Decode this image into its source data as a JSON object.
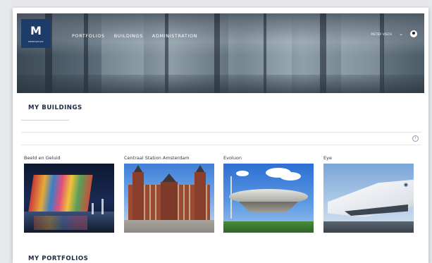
{
  "header": {
    "logo_text": "M",
    "logo_subtext": "MEERSPOOR",
    "nav": [
      "PORTFOLIOS",
      "BUILDINGS",
      "ADMINISTRATION"
    ],
    "username": "PIETER VISCH",
    "user_menu_icon": "chevron-down-icon",
    "avatar_icon": "user-avatar-icon"
  },
  "buildings_section": {
    "title": "MY BUILDINGS",
    "info_icon": "i",
    "items": [
      {
        "name": "Beeld en Geluid"
      },
      {
        "name": "Centraal Station Amsterdam"
      },
      {
        "name": "Evoluon"
      },
      {
        "name": "Eye"
      }
    ]
  },
  "portfolios_section": {
    "title": "MY PORTFOLIOS"
  },
  "colors": {
    "brand": "#1d3c6a",
    "heading": "#1b2a41",
    "page_bg": "#e6e8ec"
  }
}
